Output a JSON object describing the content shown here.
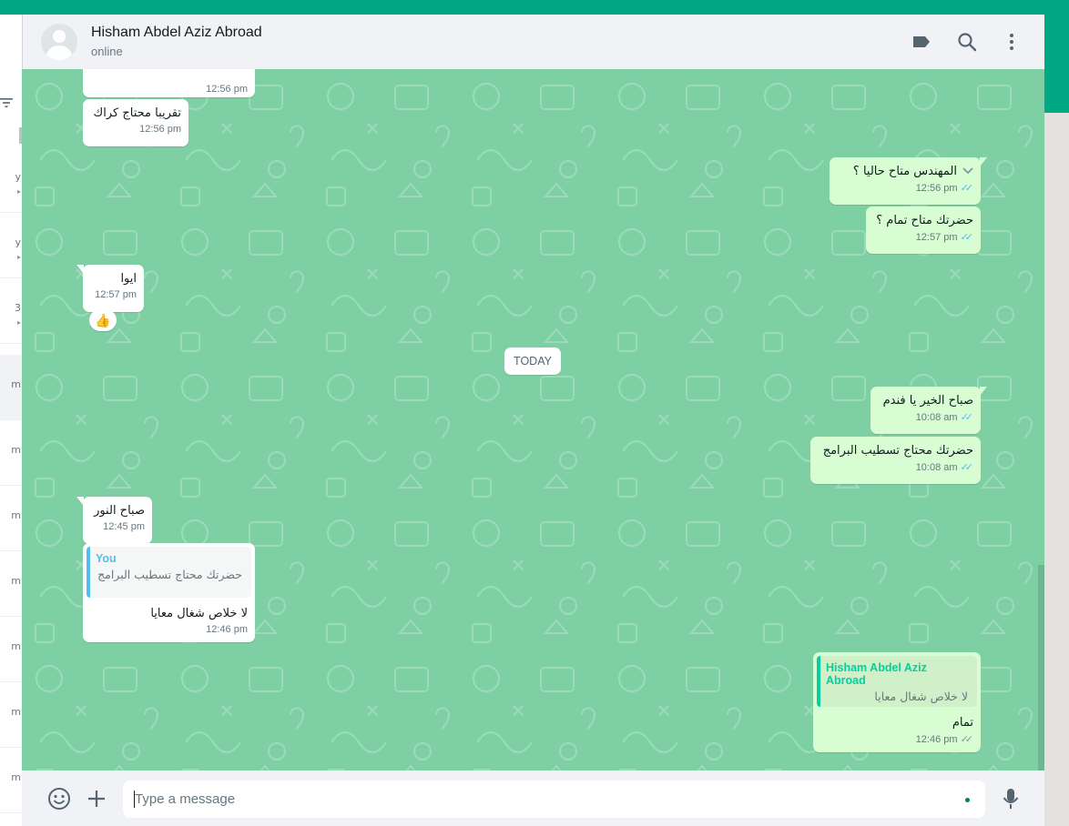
{
  "colors": {
    "accent": "#00a884",
    "chat_bg": "#7fcfa4",
    "bubble_in": "#ffffff",
    "bubble_out": "#d9fdd3",
    "read_ticks": "#53bdeb"
  },
  "sidebar": {
    "filter_icon": "filter-icon",
    "rows": [
      {
        "time": "y"
      },
      {
        "time": "y"
      },
      {
        "time": "3"
      },
      {
        "time": "m",
        "active": true
      },
      {
        "time": "m"
      },
      {
        "time": "m"
      },
      {
        "time": "m"
      },
      {
        "time": "m"
      },
      {
        "time": "m"
      },
      {
        "time": "m"
      }
    ]
  },
  "header": {
    "name": "Hisham Abdel Aziz Abroad",
    "status": "online",
    "icons": [
      "label-icon",
      "search-icon",
      "menu-icon"
    ]
  },
  "messages": {
    "m1": {
      "text": "",
      "time": "12:56 pm"
    },
    "m2": {
      "text": "تقريبا محتاج كراك",
      "time": "12:56 pm"
    },
    "m3": {
      "text": "المهندس متاح حاليا ؟",
      "time": "12:56 pm"
    },
    "m4": {
      "text": "حضرتك متاح تمام ؟",
      "time": "12:57 pm"
    },
    "m5": {
      "text": "ايوا",
      "time": "12:57 pm",
      "reaction": "👍"
    },
    "divider": "TODAY",
    "m6": {
      "text": "صباح الخير يا فندم",
      "time": "10:08 am"
    },
    "m7": {
      "text": "حضرتك محتاج تسطيب البرامج",
      "time": "10:08 am"
    },
    "m8": {
      "text": "صباح النور",
      "time": "12:45 pm"
    },
    "m9": {
      "quote_author": "You",
      "quote_text": "حضرتك محتاج تسطيب البرامج",
      "text": "لا خلاص شغال معايا",
      "time": "12:46 pm"
    },
    "m10": {
      "quote_author": "Hisham Abdel Aziz Abroad",
      "quote_text": "لا خلاص شغال معايا",
      "text": "تمام",
      "time": "12:46 pm"
    }
  },
  "composer": {
    "placeholder": "Type a message",
    "icons": [
      "emoji-icon",
      "attach-plus-icon",
      "microphone-icon"
    ]
  }
}
